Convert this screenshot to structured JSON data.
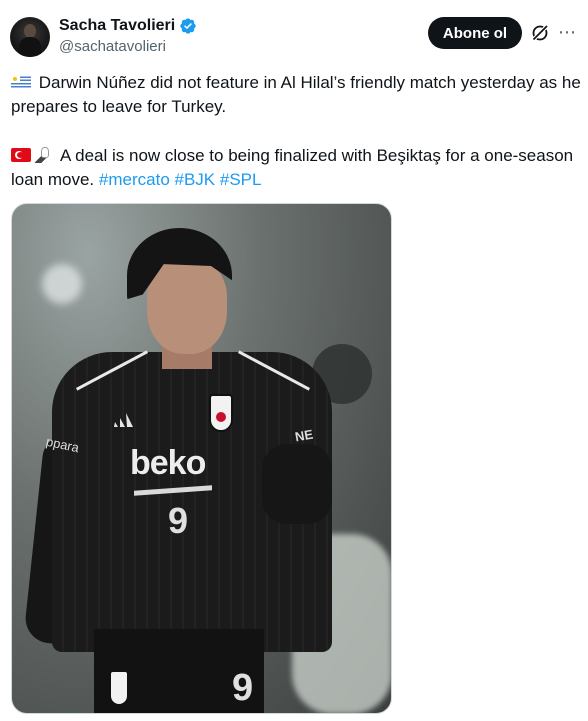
{
  "author": {
    "name": "Sacha Tavolieri",
    "handle": "@sachatavolieri",
    "verified": true,
    "verified_color": "#1d9bf0"
  },
  "actions": {
    "follow_label": "Abone ol",
    "grok_icon": "grok-icon",
    "more_icon": "more-icon"
  },
  "tweet": {
    "paragraph1": {
      "flag": "uruguay-flag",
      "text": "Darwin Núñez did not feature in Al Hilal’s friendly match yesterday as he prepares to leave for Turkey."
    },
    "paragraph2": {
      "flags": [
        "turkey-flag",
        "eagle-emoji"
      ],
      "text": "A deal is now close to being finalized with Beşiktaş for a one-season loan move.",
      "hashtags": [
        "#mercato",
        "#BJK",
        "#SPL"
      ]
    }
  },
  "media": {
    "sponsor": "beko",
    "shirt_number": "9",
    "sponsor_left": "ppara",
    "sponsor_right": "NE"
  },
  "colors": {
    "text": "#0f1419",
    "secondary": "#536471",
    "link": "#1d9bf0",
    "button_bg": "#0f1419"
  }
}
